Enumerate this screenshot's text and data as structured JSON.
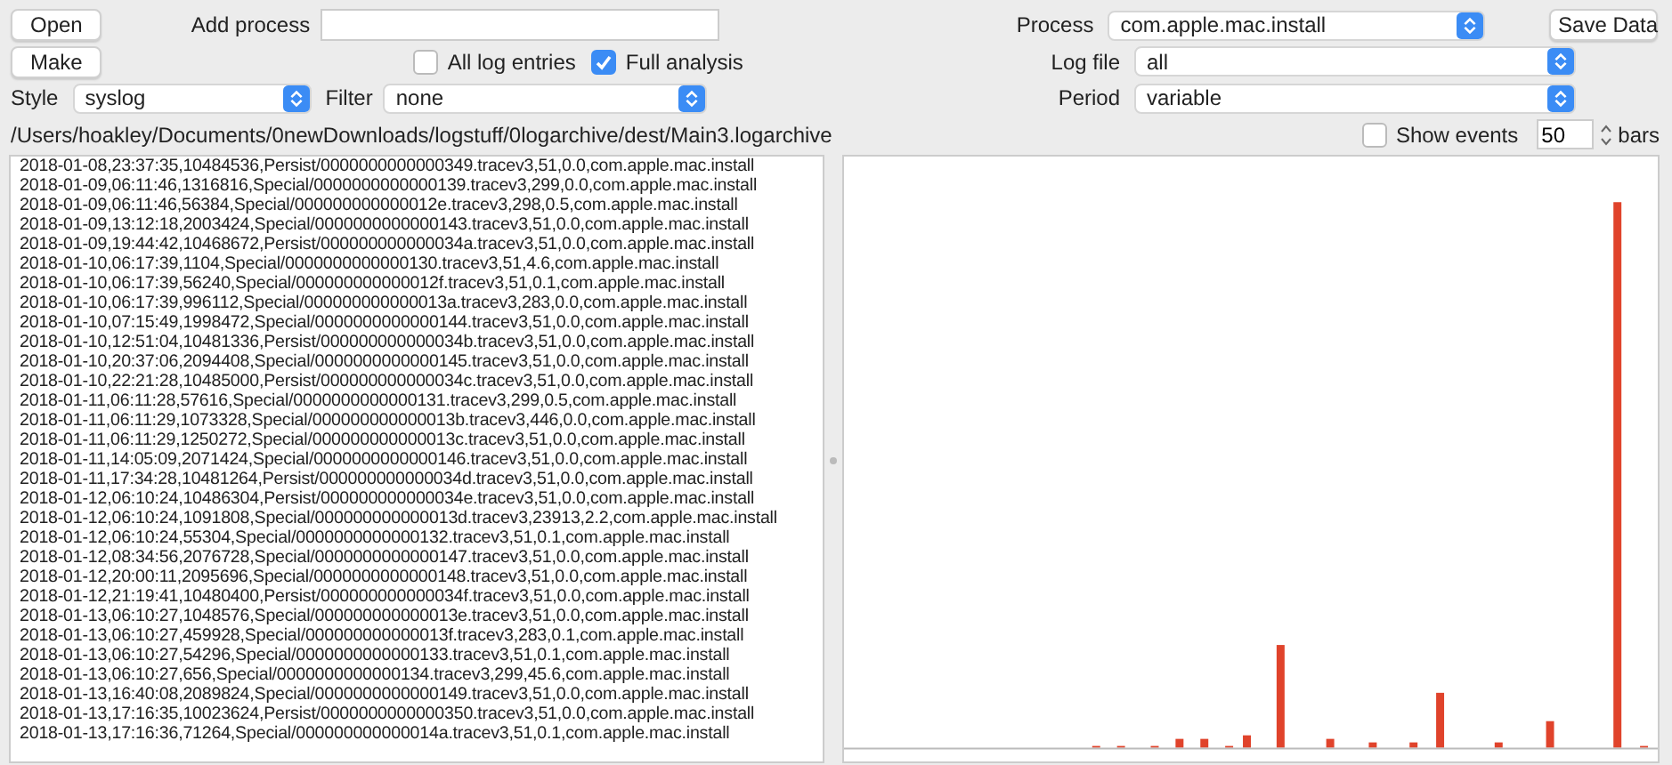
{
  "buttons": {
    "open": "Open",
    "make": "Make",
    "save": "Save Data"
  },
  "add_process": {
    "label": "Add process"
  },
  "checkboxes": [
    {
      "label": "All log entries",
      "checked": false
    },
    {
      "label": "Full analysis",
      "checked": true
    }
  ],
  "style": {
    "label": "Style",
    "value": "syslog"
  },
  "filter": {
    "label": "Filter",
    "value": "none"
  },
  "process": {
    "label": "Process",
    "value": "com.apple.mac.install"
  },
  "log_file": {
    "label": "Log file",
    "value": "all"
  },
  "period": {
    "label": "Period",
    "value": "variable"
  },
  "path": "/Users/hoakley/Documents/0newDownloads/logstuff/0logarchive/dest/Main3.logarchive",
  "show_events": {
    "label": "Show events",
    "checked": false
  },
  "bars": {
    "value": "50",
    "label": "bars"
  },
  "log_lines": [
    "2018-01-08,23:37:35,10484536,Persist/0000000000000349.tracev3,51,0.0,com.apple.mac.install",
    "2018-01-09,06:11:46,1316816,Special/0000000000000139.tracev3,299,0.0,com.apple.mac.install",
    "2018-01-09,06:11:46,56384,Special/000000000000012e.tracev3,298,0.5,com.apple.mac.install",
    "2018-01-09,13:12:18,2003424,Special/0000000000000143.tracev3,51,0.0,com.apple.mac.install",
    "2018-01-09,19:44:42,10468672,Persist/000000000000034a.tracev3,51,0.0,com.apple.mac.install",
    "2018-01-10,06:17:39,1104,Special/0000000000000130.tracev3,51,4.6,com.apple.mac.install",
    "2018-01-10,06:17:39,56240,Special/000000000000012f.tracev3,51,0.1,com.apple.mac.install",
    "2018-01-10,06:17:39,996112,Special/000000000000013a.tracev3,283,0.0,com.apple.mac.install",
    "2018-01-10,07:15:49,1998472,Special/0000000000000144.tracev3,51,0.0,com.apple.mac.install",
    "2018-01-10,12:51:04,10481336,Persist/000000000000034b.tracev3,51,0.0,com.apple.mac.install",
    "2018-01-10,20:37:06,2094408,Special/0000000000000145.tracev3,51,0.0,com.apple.mac.install",
    "2018-01-10,22:21:28,10485000,Persist/000000000000034c.tracev3,51,0.0,com.apple.mac.install",
    "2018-01-11,06:11:28,57616,Special/0000000000000131.tracev3,299,0.5,com.apple.mac.install",
    "2018-01-11,06:11:29,1073328,Special/000000000000013b.tracev3,446,0.0,com.apple.mac.install",
    "2018-01-11,06:11:29,1250272,Special/000000000000013c.tracev3,51,0.0,com.apple.mac.install",
    "2018-01-11,14:05:09,2071424,Special/0000000000000146.tracev3,51,0.0,com.apple.mac.install",
    "2018-01-11,17:34:28,10481264,Persist/000000000000034d.tracev3,51,0.0,com.apple.mac.install",
    "2018-01-12,06:10:24,10486304,Persist/000000000000034e.tracev3,51,0.0,com.apple.mac.install",
    "2018-01-12,06:10:24,1091808,Special/000000000000013d.tracev3,23913,2.2,com.apple.mac.install",
    "2018-01-12,06:10:24,55304,Special/0000000000000132.tracev3,51,0.1,com.apple.mac.install",
    "2018-01-12,08:34:56,2076728,Special/0000000000000147.tracev3,51,0.0,com.apple.mac.install",
    "2018-01-12,20:00:11,2095696,Special/0000000000000148.tracev3,51,0.0,com.apple.mac.install",
    "2018-01-12,21:19:41,10480400,Persist/000000000000034f.tracev3,51,0.0,com.apple.mac.install",
    "2018-01-13,06:10:27,1048576,Special/000000000000013e.tracev3,51,0.0,com.apple.mac.install",
    "2018-01-13,06:10:27,459928,Special/000000000000013f.tracev3,283,0.1,com.apple.mac.install",
    "2018-01-13,06:10:27,54296,Special/0000000000000133.tracev3,51,0.1,com.apple.mac.install",
    "2018-01-13,06:10:27,656,Special/0000000000000134.tracev3,299,45.6,com.apple.mac.install",
    "2018-01-13,16:40:08,2089824,Special/0000000000000149.tracev3,51,0.0,com.apple.mac.install",
    "2018-01-13,17:16:35,10023624,Persist/0000000000000350.tracev3,51,0.0,com.apple.mac.install",
    "2018-01-13,17:16:36,71264,Special/000000000000014a.tracev3,51,0.1,com.apple.mac.install"
  ]
}
